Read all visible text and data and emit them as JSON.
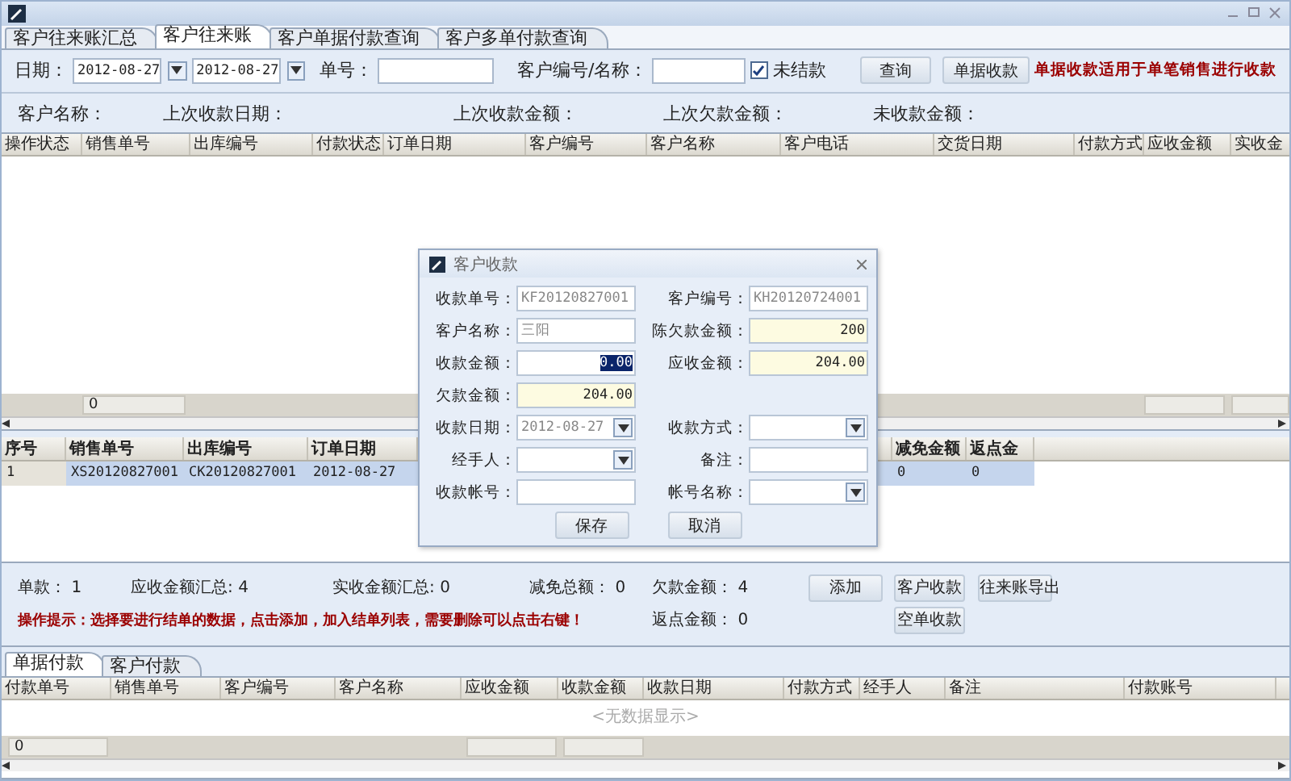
{
  "tabs": [
    {
      "label": "客户往来账汇总",
      "selected": false
    },
    {
      "label": "客户往来账",
      "selected": true
    },
    {
      "label": "客户单据付款查询",
      "selected": false
    },
    {
      "label": "客户多单付款查询",
      "selected": false
    }
  ],
  "filter": {
    "date_label": "日期：",
    "date_from": "2012-08-27",
    "date_to": "2012-08-27",
    "order_label": "单号：",
    "customer_label": "客户编号/名称：",
    "unsettled": {
      "label": "未结款",
      "checked": true
    },
    "query_button": "查询",
    "receipt_button": "单据收款",
    "hint": "单据收款适用于单笔销售进行收款"
  },
  "info": [
    "客户名称：",
    "上次收款日期：",
    "上次收款金额：",
    "上次欠款金额：",
    "未收款金额："
  ],
  "upper_table": {
    "columns": [
      "操作状态",
      "销售单号",
      "出库编号",
      "付款状态",
      "订单日期",
      "客户编号",
      "客户名称",
      "客户电话",
      "交货日期",
      "付款方式",
      "应收金额",
      "实收金"
    ],
    "footer": "0"
  },
  "lower_table": {
    "columns": [
      "序号",
      "销售单号",
      "出库编号",
      "订单日期",
      "减免金额",
      "返点金"
    ],
    "rows": [
      {
        "cells": [
          "1",
          "XS20120827001",
          "CK20120827001",
          "2012-08-27",
          "0",
          "0"
        ],
        "selected": true
      }
    ]
  },
  "summary": {
    "line1": [
      {
        "label": "单款：",
        "value": "1"
      },
      {
        "label": "应收金额汇总:",
        "value": "4"
      },
      {
        "label": "实收金额汇总:",
        "value": "0"
      },
      {
        "label": "减免总额：",
        "value": "0"
      },
      {
        "label": "欠款金额：",
        "value": "4"
      }
    ],
    "hint": "操作提示：选择要进行结单的数据，点击添加，加入结单列表，需要删除可以点击右键！",
    "rebate": {
      "label": "返点金额：",
      "value": "0"
    },
    "buttons": [
      "添加",
      "客户收款",
      "往来账导出",
      "空单收款"
    ]
  },
  "bottom_tabs": [
    {
      "label": "单据付款",
      "selected": true
    },
    {
      "label": "客户付款",
      "selected": false
    }
  ],
  "bottom_table": {
    "columns": [
      "付款单号",
      "销售单号",
      "客户编号",
      "客户名称",
      "应收金额",
      "收款金额",
      "收款日期",
      "付款方式",
      "经手人",
      "备注",
      "付款账号"
    ],
    "empty": "<无数据显示>",
    "footer": "0"
  },
  "dialog": {
    "title": "客户收款",
    "rows": [
      [
        {
          "label": "收款单号：",
          "kind": "text",
          "value": "KF20120827001",
          "disabled": true
        },
        {
          "label": "客户编号：",
          "kind": "text",
          "value": "KH20120724001",
          "disabled": true
        }
      ],
      [
        {
          "label": "客户名称：",
          "kind": "text",
          "value": "三阳",
          "disabled": true
        },
        {
          "label": "陈欠款金额：",
          "kind": "text",
          "value": "200",
          "highlight": true
        }
      ],
      [
        {
          "label": "收款金额：",
          "kind": "text",
          "value": "0.00",
          "text_selected": true
        },
        {
          "label": "应收金额：",
          "kind": "text",
          "value": "204.00",
          "highlight": true
        }
      ],
      [
        {
          "label": "欠款金额：",
          "kind": "text",
          "value": "204.00",
          "highlight": true
        }
      ],
      [
        {
          "label": "收款日期：",
          "kind": "select",
          "value": "2012-08-27",
          "disabled": true
        },
        {
          "label": "收款方式：",
          "kind": "select"
        }
      ],
      [
        {
          "label": "经手人：",
          "kind": "select"
        },
        {
          "label": "备注：",
          "kind": "text"
        }
      ],
      [
        {
          "label": "收款帐号：",
          "kind": "text"
        },
        {
          "label": "帐号名称：",
          "kind": "select"
        }
      ]
    ],
    "buttons": [
      "保存",
      "取消"
    ]
  }
}
